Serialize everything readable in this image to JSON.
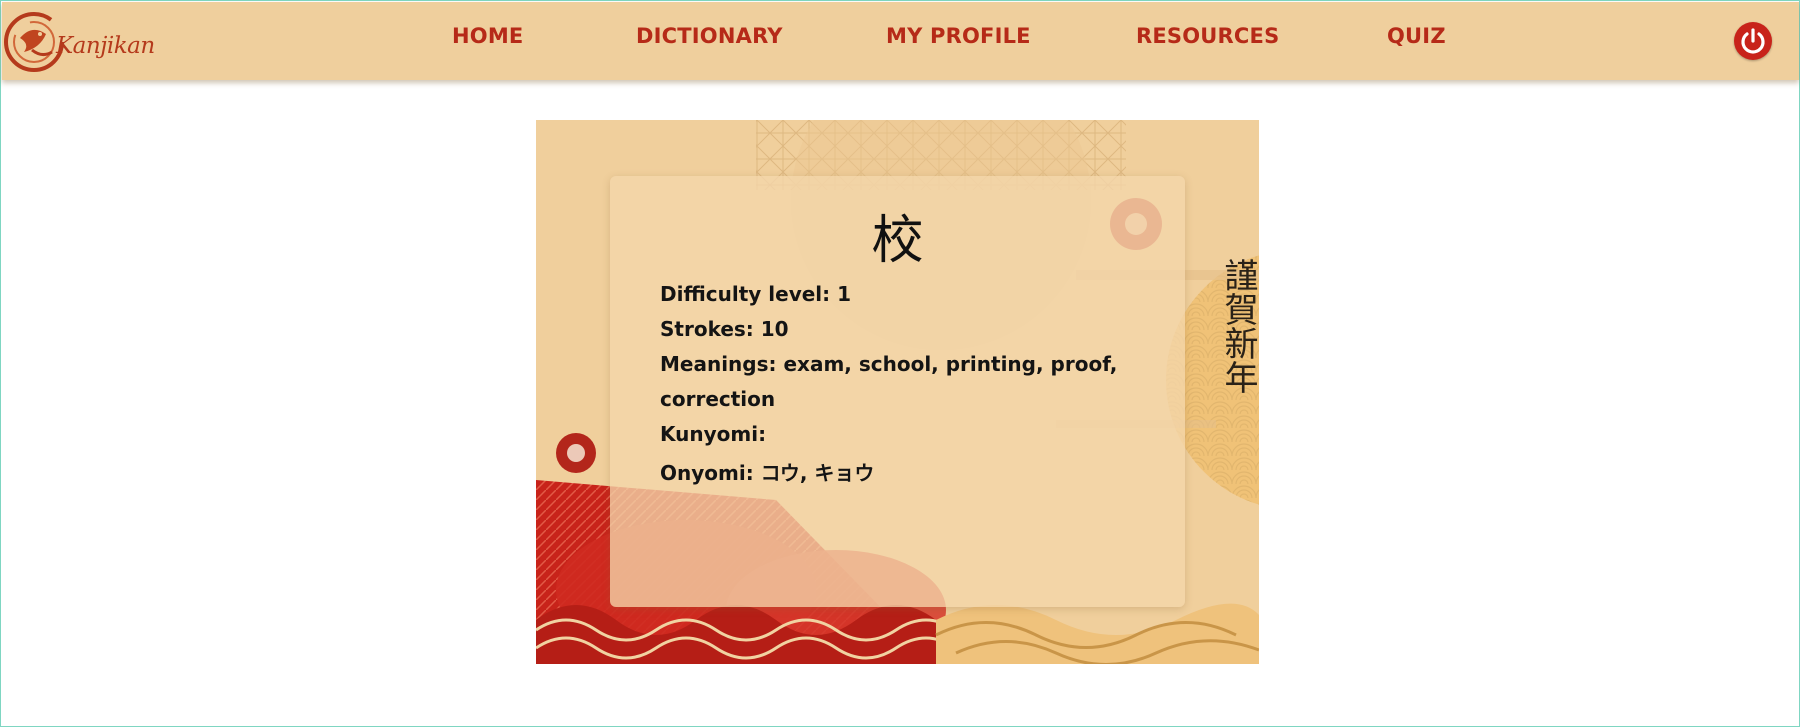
{
  "app": {
    "logo_text": "Kanjikan"
  },
  "nav": {
    "items": [
      {
        "label": "HOME"
      },
      {
        "label": "DICTIONARY"
      },
      {
        "label": "MY PROFILE"
      },
      {
        "label": "RESOURCES"
      },
      {
        "label": "QUIZ"
      }
    ],
    "logout_icon": "power-icon"
  },
  "card": {
    "kanji": "校",
    "difficulty": "Difficulty level: 1",
    "strokes": "Strokes: 10",
    "meanings_line1": "Meanings: exam, school, printing, proof,",
    "meanings_line2": "correction",
    "kunyomi": "Kunyomi:",
    "onyomi": "Onyomi: コウ, キョウ",
    "decor_text": "謹賀新年"
  },
  "colors": {
    "nav_bg": "#efcf9d",
    "nav_text": "#b62a18",
    "accent_red": "#c8231a",
    "card_bg": "#f0cf9c"
  }
}
